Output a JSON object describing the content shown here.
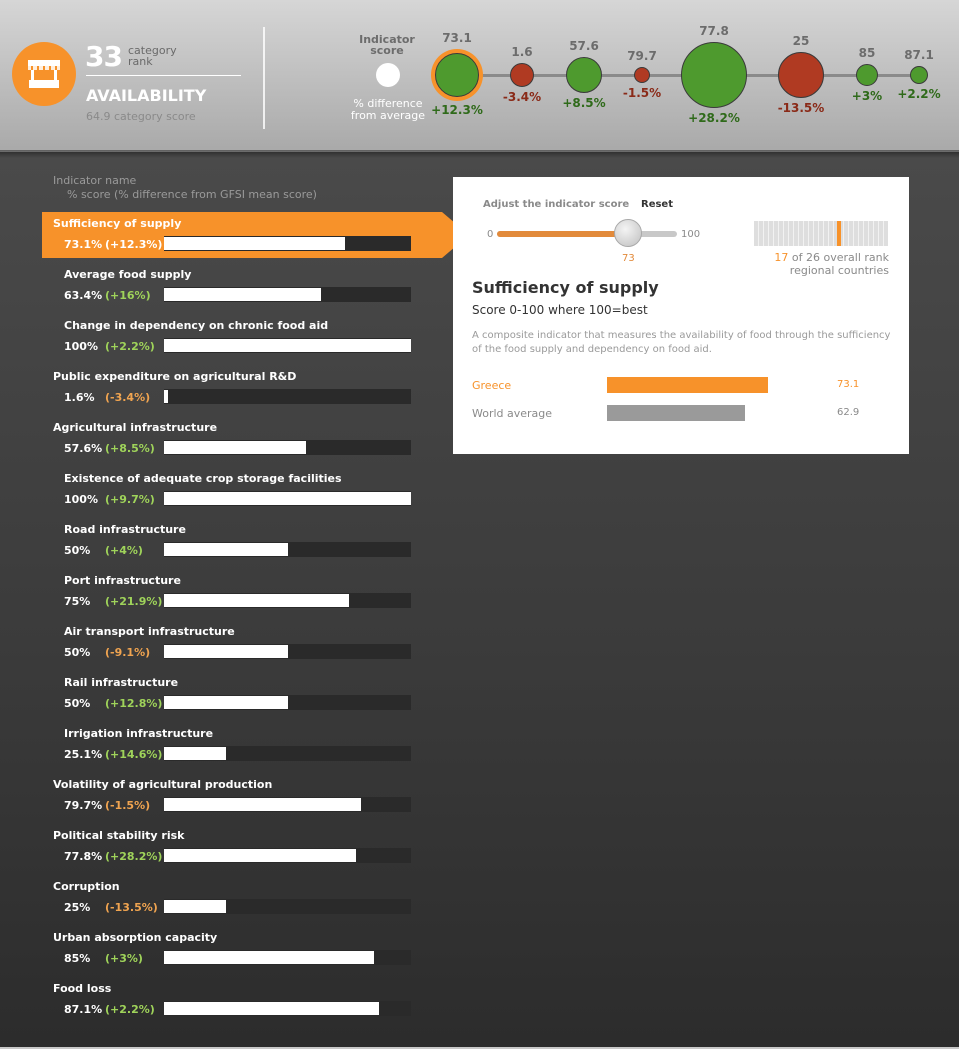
{
  "category": {
    "icon": "market-stall-icon",
    "rank": "33",
    "rank_label": "category rank",
    "name": "AVAILABILITY",
    "score_text": "64.9 category score"
  },
  "legend": {
    "score_label": "Indicator score",
    "diff_label": "% difference from average"
  },
  "bubbles": [
    {
      "value": "73.1",
      "diff": "+12.3%",
      "score": 73.1,
      "positive": true,
      "selected": true
    },
    {
      "value": "1.6",
      "diff": "-3.4%",
      "score": 1.6,
      "positive": false,
      "selected": false
    },
    {
      "value": "57.6",
      "diff": "+8.5%",
      "score": 57.6,
      "positive": true,
      "selected": false
    },
    {
      "value": "79.7",
      "diff": "-1.5%",
      "score": 79.7,
      "positive": false,
      "selected": false
    },
    {
      "value": "77.8",
      "diff": "+28.2%",
      "score": 77.8,
      "positive": true,
      "selected": false
    },
    {
      "value": "25",
      "diff": "-13.5%",
      "score": 25,
      "positive": false,
      "selected": false
    },
    {
      "value": "85",
      "diff": "+3%",
      "score": 85,
      "positive": true,
      "selected": false
    },
    {
      "value": "87.1",
      "diff": "+2.2%",
      "score": 87.1,
      "positive": true,
      "selected": false
    }
  ],
  "list": {
    "header_name": "Indicator name",
    "header_score": "% score (% difference from GFSI mean score)",
    "indicators": [
      {
        "name": "Sufficiency of supply",
        "pct": "73.1%",
        "diff": "(+12.3%)",
        "score": 73.1,
        "positive": true,
        "level": 0,
        "selected": true
      },
      {
        "name": "Average food supply",
        "pct": "63.4%",
        "diff": "(+16%)",
        "score": 63.4,
        "positive": true,
        "level": 1,
        "selected": false
      },
      {
        "name": "Change in dependency on chronic food aid",
        "pct": "100%",
        "diff": "(+2.2%)",
        "score": 100,
        "positive": true,
        "level": 1,
        "selected": false
      },
      {
        "name": "Public expenditure on agricultural R&D",
        "pct": "1.6%",
        "diff": "(-3.4%)",
        "score": 1.6,
        "positive": false,
        "level": 0,
        "selected": false
      },
      {
        "name": "Agricultural infrastructure",
        "pct": "57.6%",
        "diff": "(+8.5%)",
        "score": 57.6,
        "positive": true,
        "level": 0,
        "selected": false
      },
      {
        "name": "Existence of adequate crop storage facilities",
        "pct": "100%",
        "diff": "(+9.7%)",
        "score": 100,
        "positive": true,
        "level": 1,
        "selected": false
      },
      {
        "name": "Road infrastructure",
        "pct": "50%",
        "diff": "(+4%)",
        "score": 50,
        "positive": true,
        "level": 1,
        "selected": false
      },
      {
        "name": "Port infrastructure",
        "pct": "75%",
        "diff": "(+21.9%)",
        "score": 75,
        "positive": true,
        "level": 1,
        "selected": false
      },
      {
        "name": "Air transport infrastructure",
        "pct": "50%",
        "diff": "(-9.1%)",
        "score": 50,
        "positive": false,
        "level": 1,
        "selected": false
      },
      {
        "name": "Rail infrastructure",
        "pct": "50%",
        "diff": "(+12.8%)",
        "score": 50,
        "positive": true,
        "level": 1,
        "selected": false
      },
      {
        "name": "Irrigation infrastructure",
        "pct": "25.1%",
        "diff": "(+14.6%)",
        "score": 25.1,
        "positive": true,
        "level": 1,
        "selected": false
      },
      {
        "name": "Volatility of agricultural production",
        "pct": "79.7%",
        "diff": "(-1.5%)",
        "score": 79.7,
        "positive": false,
        "level": 0,
        "selected": false
      },
      {
        "name": "Political stability risk",
        "pct": "77.8%",
        "diff": "(+28.2%)",
        "score": 77.8,
        "positive": true,
        "level": 0,
        "selected": false
      },
      {
        "name": "Corruption",
        "pct": "25%",
        "diff": "(-13.5%)",
        "score": 25,
        "positive": false,
        "level": 0,
        "selected": false
      },
      {
        "name": "Urban absorption capacity",
        "pct": "85%",
        "diff": "(+3%)",
        "score": 85,
        "positive": true,
        "level": 0,
        "selected": false
      },
      {
        "name": "Food loss",
        "pct": "87.1%",
        "diff": "(+2.2%)",
        "score": 87.1,
        "positive": true,
        "level": 0,
        "selected": false
      }
    ]
  },
  "panel": {
    "adjust_label": "Adjust the indicator score",
    "reset_label": "Reset",
    "slider_min": "0",
    "slider_max": "100",
    "slider_value": "73",
    "slider_level": 73,
    "rank_position": "17",
    "rank_rest": "of 26 overall rank",
    "rank_sub": "regional countries",
    "rank_fraction": 0.62,
    "title": "Sufficiency of supply",
    "scale": "Score 0-100 where 100=best",
    "description": "A composite indicator that measures the availability of food through the sufficiency of the food supply and dependency on food aid.",
    "comparisons": [
      {
        "name": "Greece",
        "value": "73.1",
        "score": 73.1,
        "color": "#f7922a"
      },
      {
        "name": "World average",
        "value": "62.9",
        "score": 62.9,
        "color": "#9a9a9a"
      }
    ]
  },
  "colors": {
    "accent": "#f7922a",
    "positive_bubble": "#4e9a2e",
    "negative_bubble": "#b03a22",
    "positive_text_header": "#2f6a1a",
    "negative_text_header": "#8a2a18",
    "positive_text_list": "#9fd35a",
    "negative_text_list": "#f0a450"
  }
}
